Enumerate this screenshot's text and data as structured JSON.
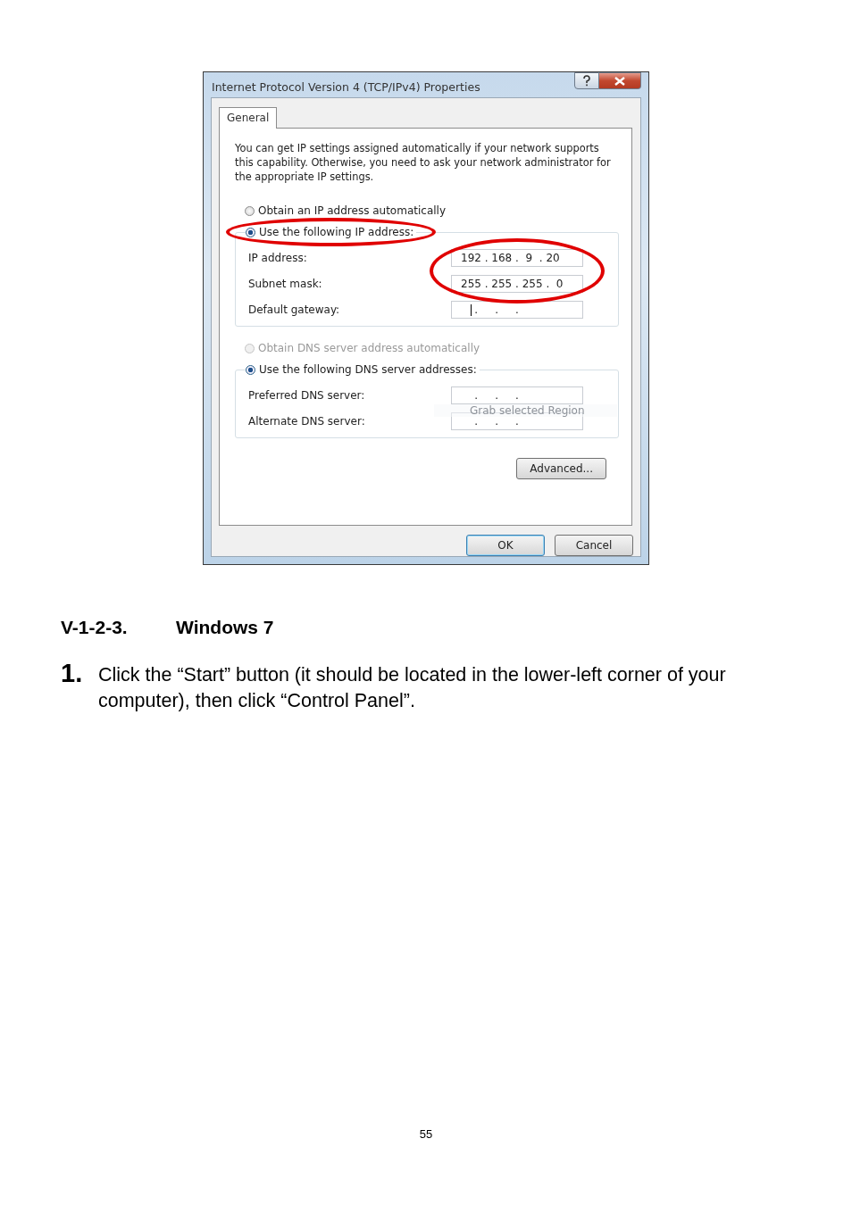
{
  "dialog": {
    "title": "Internet Protocol Version 4 (TCP/IPv4) Properties",
    "tabs": [
      {
        "label": "General",
        "selected": true
      }
    ],
    "intro": "You can get IP settings assigned automatically if your network supports this capability. Otherwise, you need to ask your network administrator for the appropriate IP settings.",
    "ip_section": {
      "options": [
        {
          "label": "Obtain an IP address automatically",
          "selected": false,
          "disabled": false,
          "circled": false
        },
        {
          "label": "Use the following IP address:",
          "selected": true,
          "disabled": false,
          "circled": true
        }
      ],
      "fields": [
        {
          "label": "IP address:",
          "value": "192 . 168 .  9  . 20",
          "focused": false,
          "circled": true
        },
        {
          "label": "Subnet mask:",
          "value": "255 . 255 . 255 .  0",
          "focused": false,
          "circled": true
        },
        {
          "label": "Default gateway:",
          "value": "    .     .     .",
          "focused": true,
          "circled": false
        }
      ]
    },
    "dns_section": {
      "options": [
        {
          "label": "Obtain DNS server address automatically",
          "selected": false,
          "disabled": true,
          "circled": false
        },
        {
          "label": "Use the following DNS server addresses:",
          "selected": true,
          "disabled": false,
          "circled": false
        }
      ],
      "fields": [
        {
          "label": "Preferred DNS server:",
          "value": "    .     .     .",
          "focused": false,
          "circled": false
        },
        {
          "label": "Alternate DNS server:",
          "value": "    .     .     .",
          "focused": false,
          "circled": false
        }
      ]
    },
    "overlay_tooltip": "Grab selected Region",
    "advanced_button": "Advanced...",
    "buttons": [
      {
        "label": "OK",
        "default": true
      },
      {
        "label": "Cancel",
        "default": false
      }
    ]
  },
  "document": {
    "heading": {
      "number": "V-1-2-3.",
      "title": "Windows 7"
    },
    "steps": [
      {
        "number": "1.",
        "text": "Click the “Start” button (it should be located in the lower-left corner of your computer), then click “Control Panel”."
      }
    ],
    "page_number": "55"
  }
}
